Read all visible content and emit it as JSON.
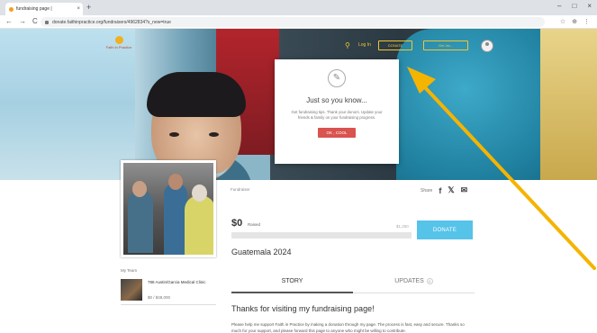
{
  "browser": {
    "tab_title": "fundraising page |",
    "tab_close": "×",
    "new_tab": "+",
    "url": "donate.faithinpractice.org/fundraisers/4962834?s_new=true",
    "nav": [
      "←",
      "→",
      "C"
    ],
    "window_controls": [
      "–",
      "□",
      "×"
    ],
    "toolbar_icons": [
      "☆",
      "⊕",
      "⋮"
    ]
  },
  "header": {
    "logo_text": "Faith in Practice",
    "login_text": "Log In",
    "search_icon": "⚲",
    "button_1": "DONATE",
    "button_2": "Get Inv..."
  },
  "modal": {
    "icon": "✎",
    "title": "Just so you know...",
    "text": "Get fundraising tips. Thank your donors. Update your friends & family on your fundraising progress.",
    "button": "OK , COOL"
  },
  "fundraiser": {
    "label": "Fundraiser",
    "share_label": "Share",
    "share_icons": [
      "f",
      "𝕏",
      "✉"
    ],
    "raised_amount": "$0",
    "raised_label": "Raised",
    "goal": "$1,250",
    "progress_fraction": 0,
    "donate_label": "DONATE",
    "campaign": "Guatemala 2024"
  },
  "team": {
    "label": "My Team",
    "name": "788 Austin/Garcia Medical Clinic",
    "amount": "$0 / $48,000"
  },
  "tabs": {
    "story": "STORY",
    "updates": "UPDATES",
    "updates_count": "0"
  },
  "story": {
    "heading": "Thanks for visiting my fundraising page!",
    "body": "Please help me support Faith in Practice by making a donation through my page. The process is fast, easy and secure. Thanks so much for your support, and please forward this page to anyone who might be willing to contribute."
  },
  "colors": {
    "donate": "#56c3e9",
    "modal_button": "#d9534f",
    "header_accent": "#f4c72e",
    "arrow": "#f5b400"
  }
}
